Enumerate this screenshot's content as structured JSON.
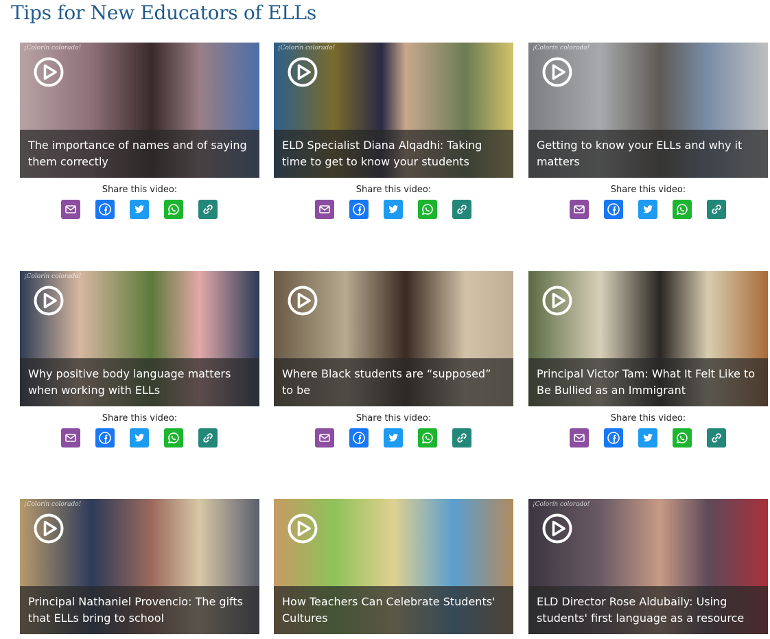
{
  "page": {
    "title": "Tips for New Educators of ELLs"
  },
  "share_label": "Share this video:",
  "share_buttons": [
    {
      "name": "email",
      "icon": "email-icon",
      "color": "#8b4ea0"
    },
    {
      "name": "facebook",
      "icon": "facebook-icon",
      "color": "#1877f2"
    },
    {
      "name": "twitter",
      "icon": "twitter-icon",
      "color": "#1d9bf0"
    },
    {
      "name": "whatsapp",
      "icon": "whatsapp-icon",
      "color": "#1db52f"
    },
    {
      "name": "copy-link",
      "icon": "link-icon",
      "color": "#23877a"
    }
  ],
  "videos": [
    {
      "title": "The importance of names and of saying them correctly",
      "brand": "¡Colorín colorado!",
      "show_share": true
    },
    {
      "title": "ELD Specialist Diana Alqadhi: Taking time to get to know your students",
      "brand": "¡Colorín colorado!",
      "show_share": true
    },
    {
      "title": "Getting to know your ELLs and why it matters",
      "brand": "¡Colorín colorado!",
      "show_share": true
    },
    {
      "title": "Why positive body language matters when working with ELLs",
      "brand": "¡Colorín colorado!",
      "show_share": true
    },
    {
      "title": "Where Black students are “supposed” to be",
      "brand": "",
      "show_share": true
    },
    {
      "title": "Principal Victor Tam: What It Felt Like to Be Bullied as an Immigrant",
      "brand": "",
      "show_share": true
    },
    {
      "title": "Principal Nathaniel Provencio: The gifts that ELLs bring to school",
      "brand": "¡Colorín colorado!",
      "show_share": false
    },
    {
      "title": "How Teachers Can Celebrate Students' Cultures",
      "brand": "",
      "show_share": false
    },
    {
      "title": "ELD Director Rose Aldubaily: Using students' first language as a resource",
      "brand": "¡Colorín colorado!",
      "show_share": false
    }
  ]
}
